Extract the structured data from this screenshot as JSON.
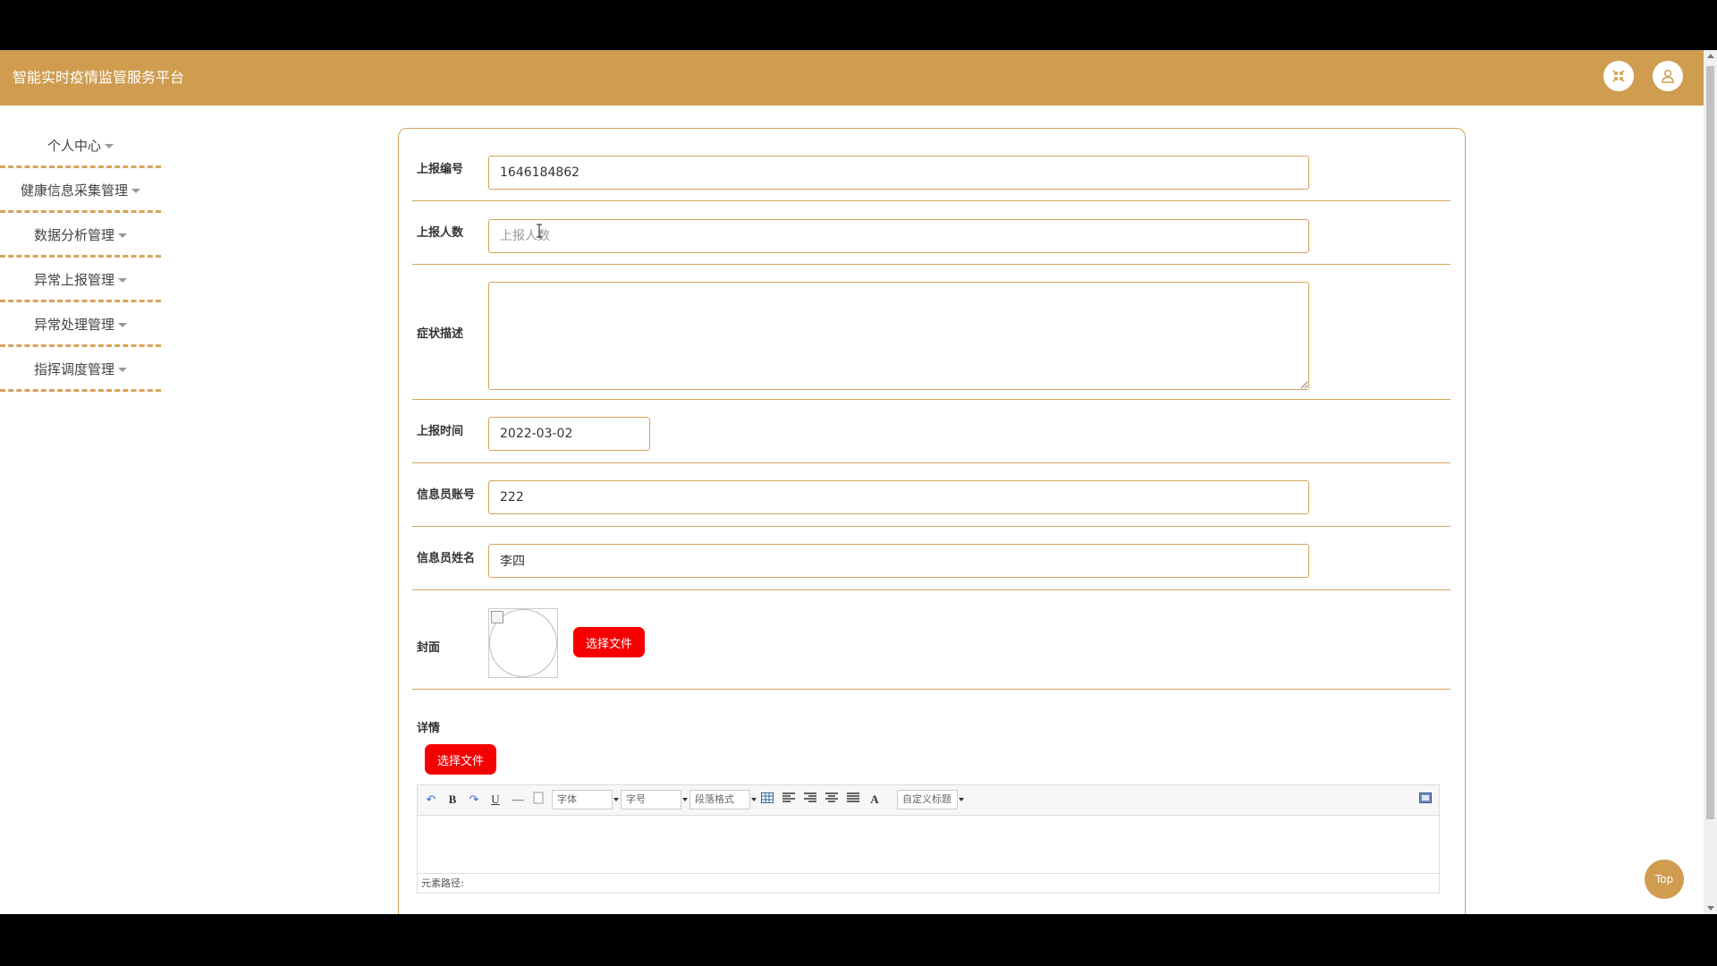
{
  "app": {
    "title": "智能实时疫情监管服务平台"
  },
  "header": {
    "fullscreen_icon": "fullscreen-exit-icon",
    "user_icon": "user-icon"
  },
  "sidebar": {
    "items": [
      {
        "label": "个人中心"
      },
      {
        "label": "健康信息采集管理"
      },
      {
        "label": "数据分析管理"
      },
      {
        "label": "异常上报管理"
      },
      {
        "label": "异常处理管理"
      },
      {
        "label": "指挥调度管理"
      }
    ]
  },
  "form": {
    "report_no": {
      "label": "上报编号",
      "value": "1646184862"
    },
    "report_count": {
      "label": "上报人数",
      "value": "",
      "placeholder": "上报人数"
    },
    "symptom": {
      "label": "症状描述",
      "value": ""
    },
    "report_time": {
      "label": "上报时间",
      "value": "2022-03-02"
    },
    "officer_account": {
      "label": "信息员账号",
      "value": "222"
    },
    "officer_name": {
      "label": "信息员姓名",
      "value": "李四"
    },
    "cover": {
      "label": "封面",
      "button": "选择文件"
    },
    "details": {
      "label": "详情",
      "button": "选择文件"
    }
  },
  "editor": {
    "toolbar": {
      "undo": "↶",
      "bold": "B",
      "redo": "↷",
      "underline": "U",
      "hr": "—",
      "font_family": "字体",
      "font_size": "字号",
      "paragraph": "段落格式",
      "font_color": "A",
      "custom_title": "自定义标题"
    },
    "path_label": "元素路径:"
  },
  "top_button": "Top",
  "colors": {
    "brand": "#cf9c50",
    "border": "#d6a45d",
    "danger": "#f50000"
  }
}
